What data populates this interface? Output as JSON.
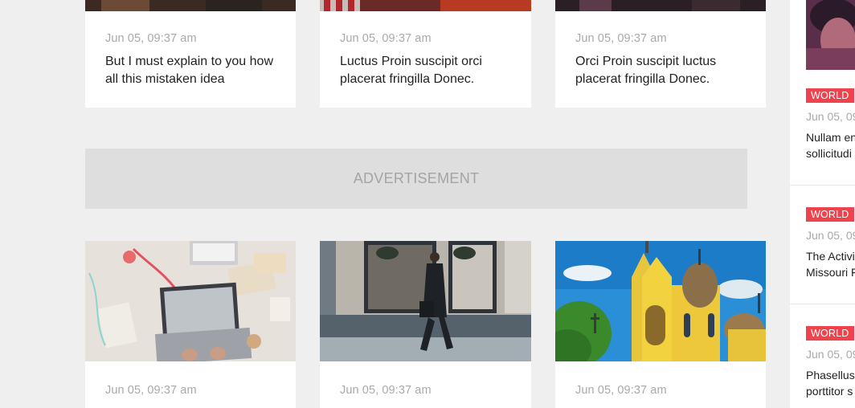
{
  "top_cards": [
    {
      "date": "Jun 05, 09:37 am",
      "title": "But I must explain to you how all this mistaken idea"
    },
    {
      "date": "Jun 05, 09:37 am",
      "title": "Luctus Proin suscipit orci placerat fringilla Donec."
    },
    {
      "date": "Jun 05, 09:37 am",
      "title": "Orci Proin suscipit luctus placerat fringilla Donec."
    }
  ],
  "advertisement": {
    "label": "ADVERTISEMENT"
  },
  "bottom_cards": [
    {
      "date": "Jun 05, 09:37 am",
      "image": "laptop-desk-photo"
    },
    {
      "date": "Jun 05, 09:37 am",
      "image": "man-walking-street-photo"
    },
    {
      "date": "Jun 05, 09:37 am",
      "image": "yellow-church-photo"
    }
  ],
  "sidebar": {
    "items": [
      {
        "category": "WORLD",
        "date": "Jun 05, 09",
        "title_lines": [
          "Nullam en",
          "sollicitudi"
        ]
      },
      {
        "category": "WORLD",
        "date": "Jun 05, 09",
        "title_lines": [
          "The Activi",
          "Missouri F"
        ]
      },
      {
        "category": "WORLD",
        "date": "Jun 05, 09",
        "title_lines": [
          "Phasellus",
          "porttitor s"
        ]
      }
    ]
  },
  "colors": {
    "badge": "#f0424d",
    "background": "#efefef",
    "ad_bg": "#dedede"
  }
}
